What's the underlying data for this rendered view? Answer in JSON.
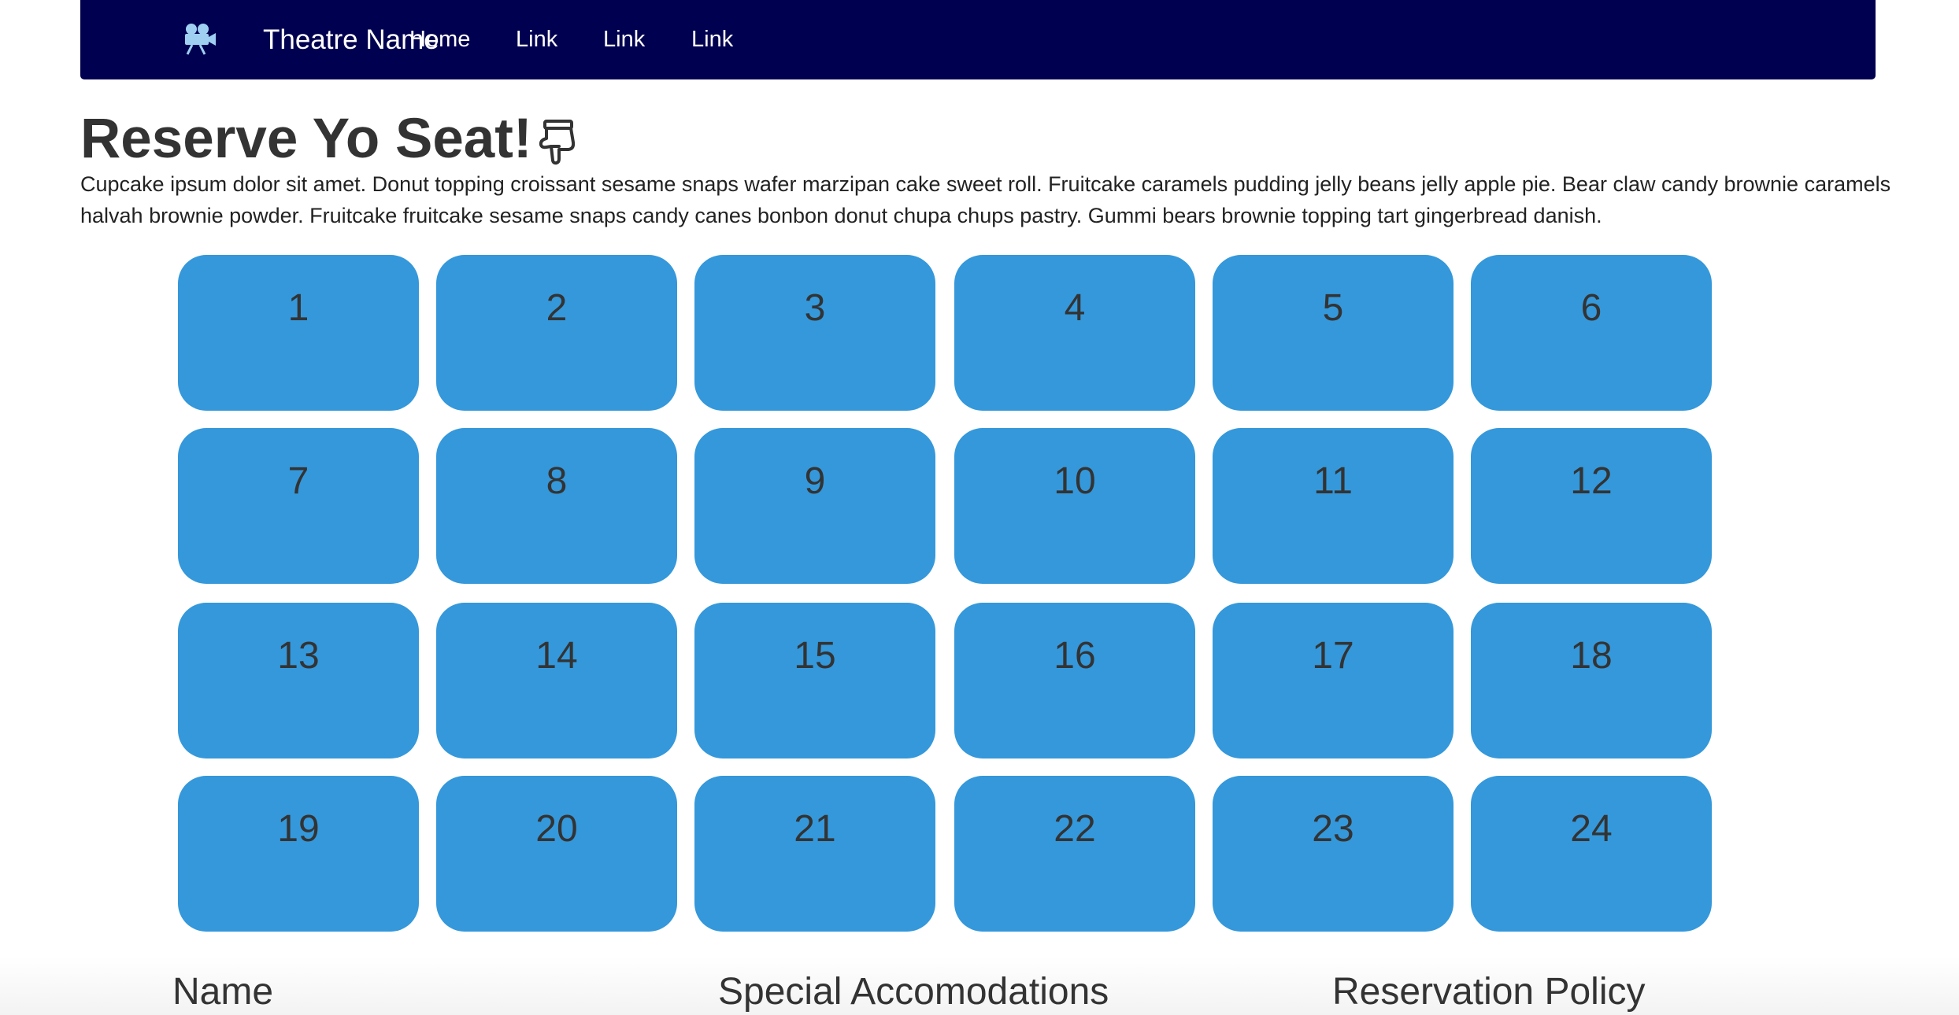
{
  "navbar": {
    "brand_icon": "film-camera-icon",
    "brand": "Theatre Name",
    "links": [
      "Home",
      "Link",
      "Link",
      "Link"
    ],
    "background": "#000050"
  },
  "header": {
    "title": "Reserve Yo Seat!",
    "title_icon": "thumbs-down-icon",
    "intro": "Cupcake ipsum dolor sit amet. Donut topping croissant sesame snaps wafer marzipan cake sweet roll. Fruitcake caramels pudding jelly beans jelly apple pie. Bear claw candy brownie caramels halvah brownie powder. Fruitcake fruitcake sesame snaps candy canes bonbon donut chupa chups pastry. Gummi bears brownie topping tart gingerbread danish."
  },
  "seats": [
    "1",
    "2",
    "3",
    "4",
    "5",
    "6",
    "7",
    "8",
    "9",
    "10",
    "11",
    "12",
    "13",
    "14",
    "15",
    "16",
    "17",
    "18",
    "19",
    "20",
    "21",
    "22",
    "23",
    "24"
  ],
  "seat_color": "#3498db",
  "sections": {
    "name": "Name",
    "special": "Special Accomodations",
    "policy": "Reservation Policy"
  }
}
